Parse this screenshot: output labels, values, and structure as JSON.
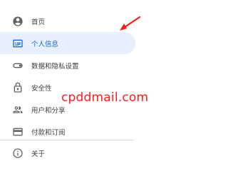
{
  "nav": {
    "items": [
      {
        "label": "首页",
        "icon": "account-circle-icon",
        "active": false
      },
      {
        "label": "个人信息",
        "icon": "id-card-icon",
        "active": true
      },
      {
        "label": "数据和隐私设置",
        "icon": "toggle-icon",
        "active": false
      },
      {
        "label": "安全性",
        "icon": "lock-icon",
        "active": false
      },
      {
        "label": "用户和分享",
        "icon": "people-icon",
        "active": false
      },
      {
        "label": "付款和订阅",
        "icon": "credit-card-icon",
        "active": false
      }
    ],
    "about_label": "关于",
    "about_icon": "info-icon"
  },
  "overlay": {
    "watermark_text": "cpddmail.com",
    "annotation": "red-arrow-pointing-to-personal-info"
  },
  "colors": {
    "active_bg": "#e8f0fe",
    "active_text": "#1967d2",
    "icon": "#5f6368",
    "text": "#3c4043",
    "watermark": "#ff1a1a"
  }
}
